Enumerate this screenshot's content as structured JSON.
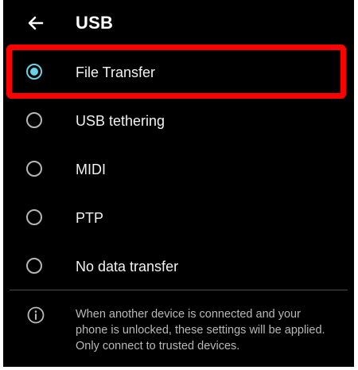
{
  "app_bar": {
    "back_icon": "arrow-back-icon",
    "title": "USB"
  },
  "options": [
    {
      "label": "File Transfer",
      "selected": true
    },
    {
      "label": "USB tethering",
      "selected": false
    },
    {
      "label": "MIDI",
      "selected": false
    },
    {
      "label": "PTP",
      "selected": false
    },
    {
      "label": "No data transfer",
      "selected": false
    }
  ],
  "info": {
    "icon": "info-icon",
    "text": "When another device is connected and your phone is unlocked, these settings will be applied. Only connect to trusted devices."
  },
  "colors": {
    "background": "#000000",
    "accent": "#6cd0e4",
    "highlight": "#ff0000",
    "radio_unchecked": "#b5b5b5",
    "secondary_text": "#b8b8b8"
  }
}
